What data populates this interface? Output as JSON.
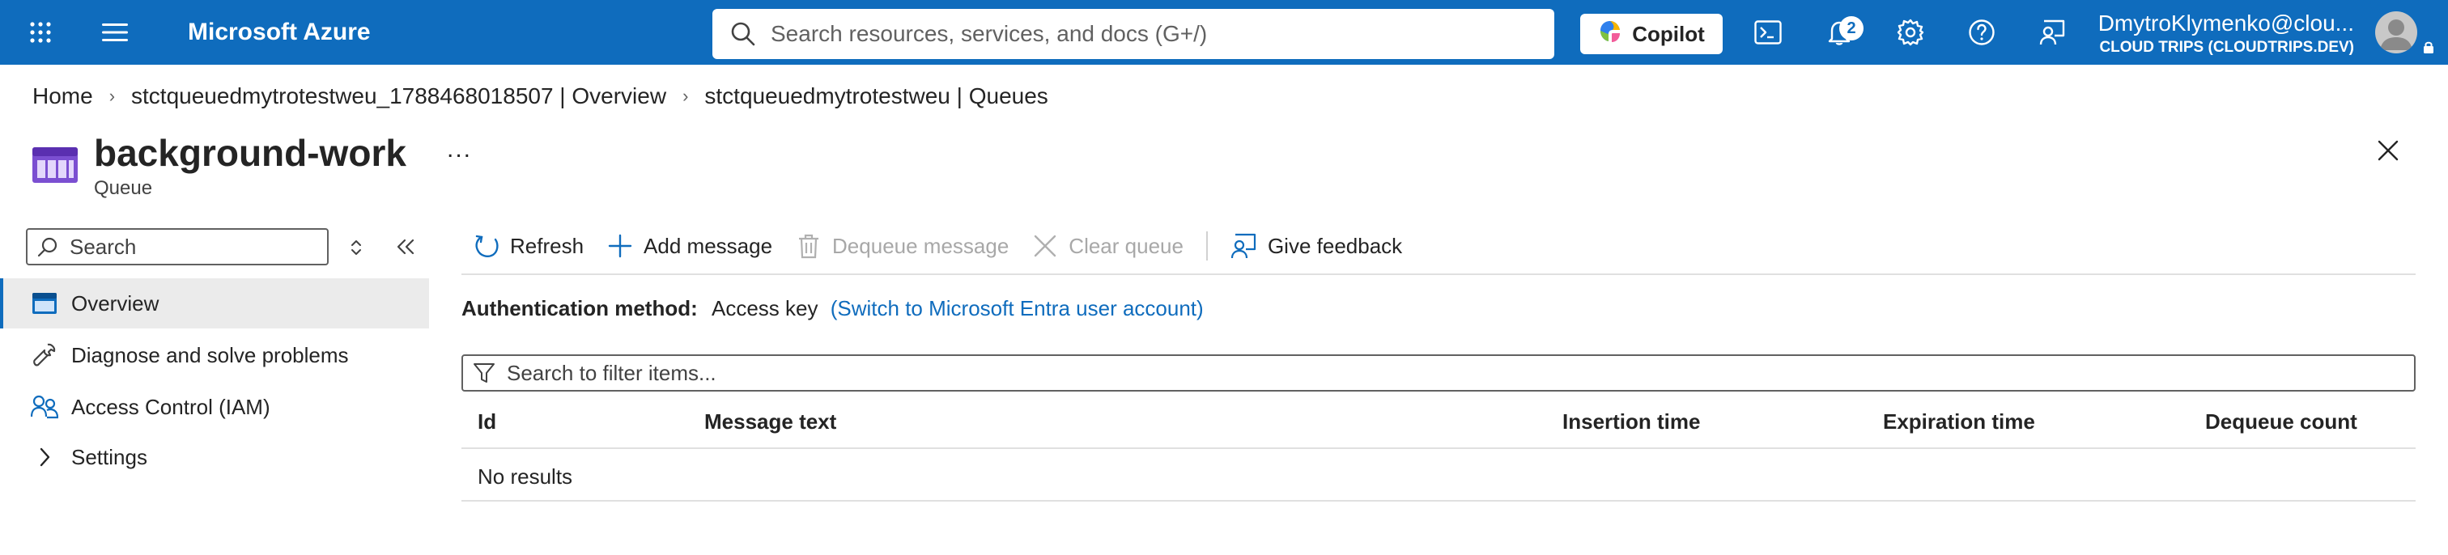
{
  "header": {
    "brand": "Microsoft Azure",
    "search_placeholder": "Search resources, services, and docs (G+/)",
    "copilot_label": "Copilot",
    "notifications_count": "2",
    "account_user": "DmytroKlymenko@clou...",
    "account_tenant": "CLOUD TRIPS (CLOUDTRIPS.DEV)",
    "accent_color": "#0f6cbd"
  },
  "breadcrumb": {
    "items": [
      "Home",
      "stctqueuedmytrotestweu_1788468018507 | Overview",
      "stctqueuedmytrotestweu | Queues"
    ]
  },
  "resource": {
    "title": "background-work",
    "type": "Queue",
    "more_label": "..."
  },
  "nav": {
    "search_placeholder": "Search",
    "items": [
      {
        "label": "Overview",
        "icon": "overview-icon",
        "active": true
      },
      {
        "label": "Diagnose and solve problems",
        "icon": "wrench-icon"
      },
      {
        "label": "Access Control (IAM)",
        "icon": "people-icon"
      },
      {
        "label": "Settings",
        "icon": "chevron-right-icon"
      }
    ]
  },
  "toolbar": {
    "refresh": "Refresh",
    "add_message": "Add message",
    "dequeue_message": "Dequeue message",
    "clear_queue": "Clear queue",
    "give_feedback": "Give feedback"
  },
  "auth": {
    "label": "Authentication method:",
    "value": "Access key",
    "switch_link": "(Switch to Microsoft Entra user account)"
  },
  "filter": {
    "placeholder": "Search to filter items..."
  },
  "table": {
    "columns": [
      "Id",
      "Message text",
      "Insertion time",
      "Expiration time",
      "Dequeue count"
    ],
    "empty_text": "No results"
  }
}
